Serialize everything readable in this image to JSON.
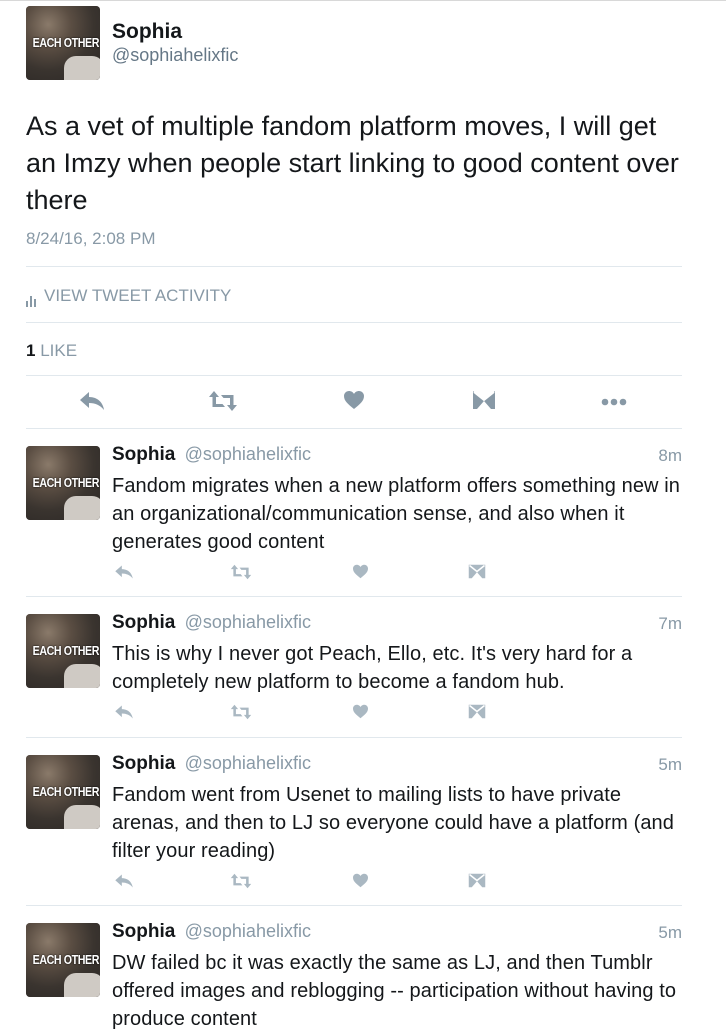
{
  "main_tweet": {
    "avatar_text": "EACH OTHER",
    "name": "Sophia",
    "handle": "@sophiahelixfic",
    "text": "As a vet of multiple fandom platform moves, I will get an Imzy when people start linking to good content over there",
    "timestamp": "8/24/16, 2:08 PM",
    "activity_label": "VIEW TWEET ACTIVITY",
    "like_count": "1",
    "like_label": "LIKE"
  },
  "icons": {
    "reply": "reply-icon",
    "retweet": "retweet-icon",
    "like": "heart-icon",
    "dm": "direct-message-icon",
    "more": "more-icon",
    "activity": "bar-chart-icon"
  },
  "colors": {
    "text": "#14171a",
    "secondary": "#8899a6",
    "divider": "#e1e8ed"
  },
  "replies": [
    {
      "avatar_text": "EACH OTHER",
      "name": "Sophia",
      "handle": "@sophiahelixfic",
      "time_ago": "8m",
      "text": "Fandom migrates when a new platform offers something new in an organizational/communication sense, and also when it generates good content"
    },
    {
      "avatar_text": "EACH OTHER",
      "name": "Sophia",
      "handle": "@sophiahelixfic",
      "time_ago": "7m",
      "text": "This is why I never got Peach, Ello, etc. It's very hard for a completely new platform to become a fandom hub."
    },
    {
      "avatar_text": "EACH OTHER",
      "name": "Sophia",
      "handle": "@sophiahelixfic",
      "time_ago": "5m",
      "text": "Fandom went from Usenet to mailing lists to have private arenas, and then to LJ so everyone could have a platform (and filter your reading)"
    },
    {
      "avatar_text": "EACH OTHER",
      "name": "Sophia",
      "handle": "@sophiahelixfic",
      "time_ago": "5m",
      "text": "DW failed bc it was exactly the same as LJ, and then Tumblr offered images and reblogging -- participation without having to produce content"
    }
  ]
}
